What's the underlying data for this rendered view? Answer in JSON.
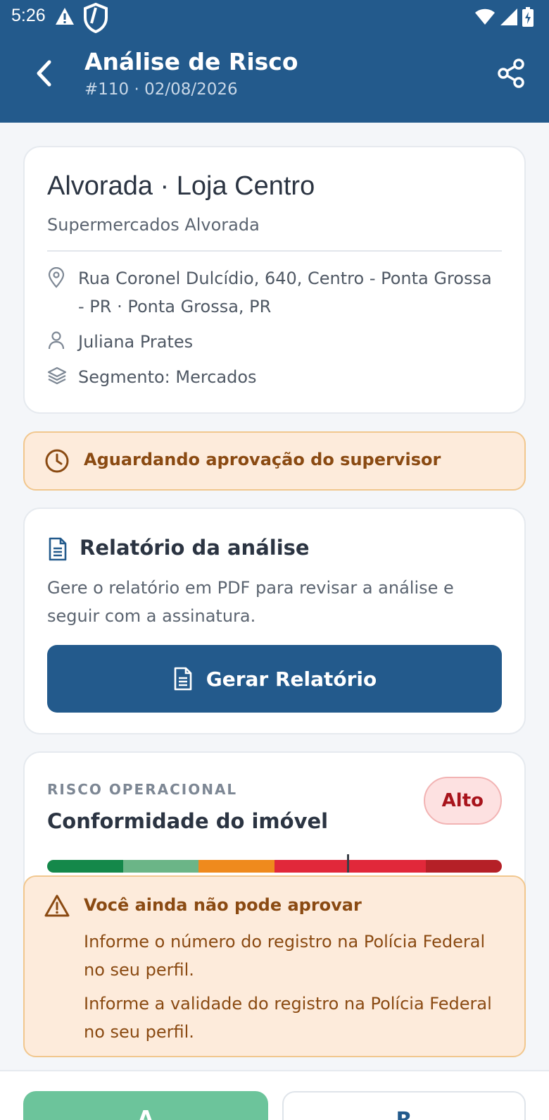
{
  "status_bar": {
    "time": "5:26"
  },
  "app_bar": {
    "title": "Análise de Risco",
    "subtitle": "#110 · 02/08/2026"
  },
  "store": {
    "name": "Alvorada · Loja Centro",
    "company": "Supermercados Alvorada",
    "address": "Rua Coronel Dulcídio, 640, Centro - Ponta Grossa - PR · Ponta Grossa, PR",
    "person": "Juliana Prates",
    "segment": "Segmento: Mercados"
  },
  "status_banner": {
    "text": "Aguardando aprovação do supervisor",
    "icon": "clock-icon"
  },
  "report": {
    "title": "Relatório da análise",
    "description": "Gere o relatório em PDF para revisar a análise e seguir com a assinatura.",
    "button_label": "Gerar Relatório"
  },
  "risk": {
    "category": "RISCO OPERACIONAL",
    "title": "Conformidade do imóvel",
    "level": "Alto",
    "scale_colors": [
      "#14884a",
      "#6bb587",
      "#ef8a1d",
      "#e1283a",
      "#e1283a",
      "#b52027"
    ],
    "marker_fraction": 0.66
  },
  "approval_warning": {
    "title": "Você ainda não pode aprovar",
    "messages": [
      "Informe o número do registro na Polícia Federal no seu perfil.",
      "Informe a validade do registro na Polícia Federal no seu perfil."
    ]
  },
  "actions": {
    "approve_label": "A",
    "reject_label": "R"
  },
  "colors": {
    "primary": "#235a8c",
    "warning_bg": "#fdebdb",
    "warning_text": "#8a4a12",
    "danger": "#a8141c",
    "success": "#6cc49b"
  }
}
